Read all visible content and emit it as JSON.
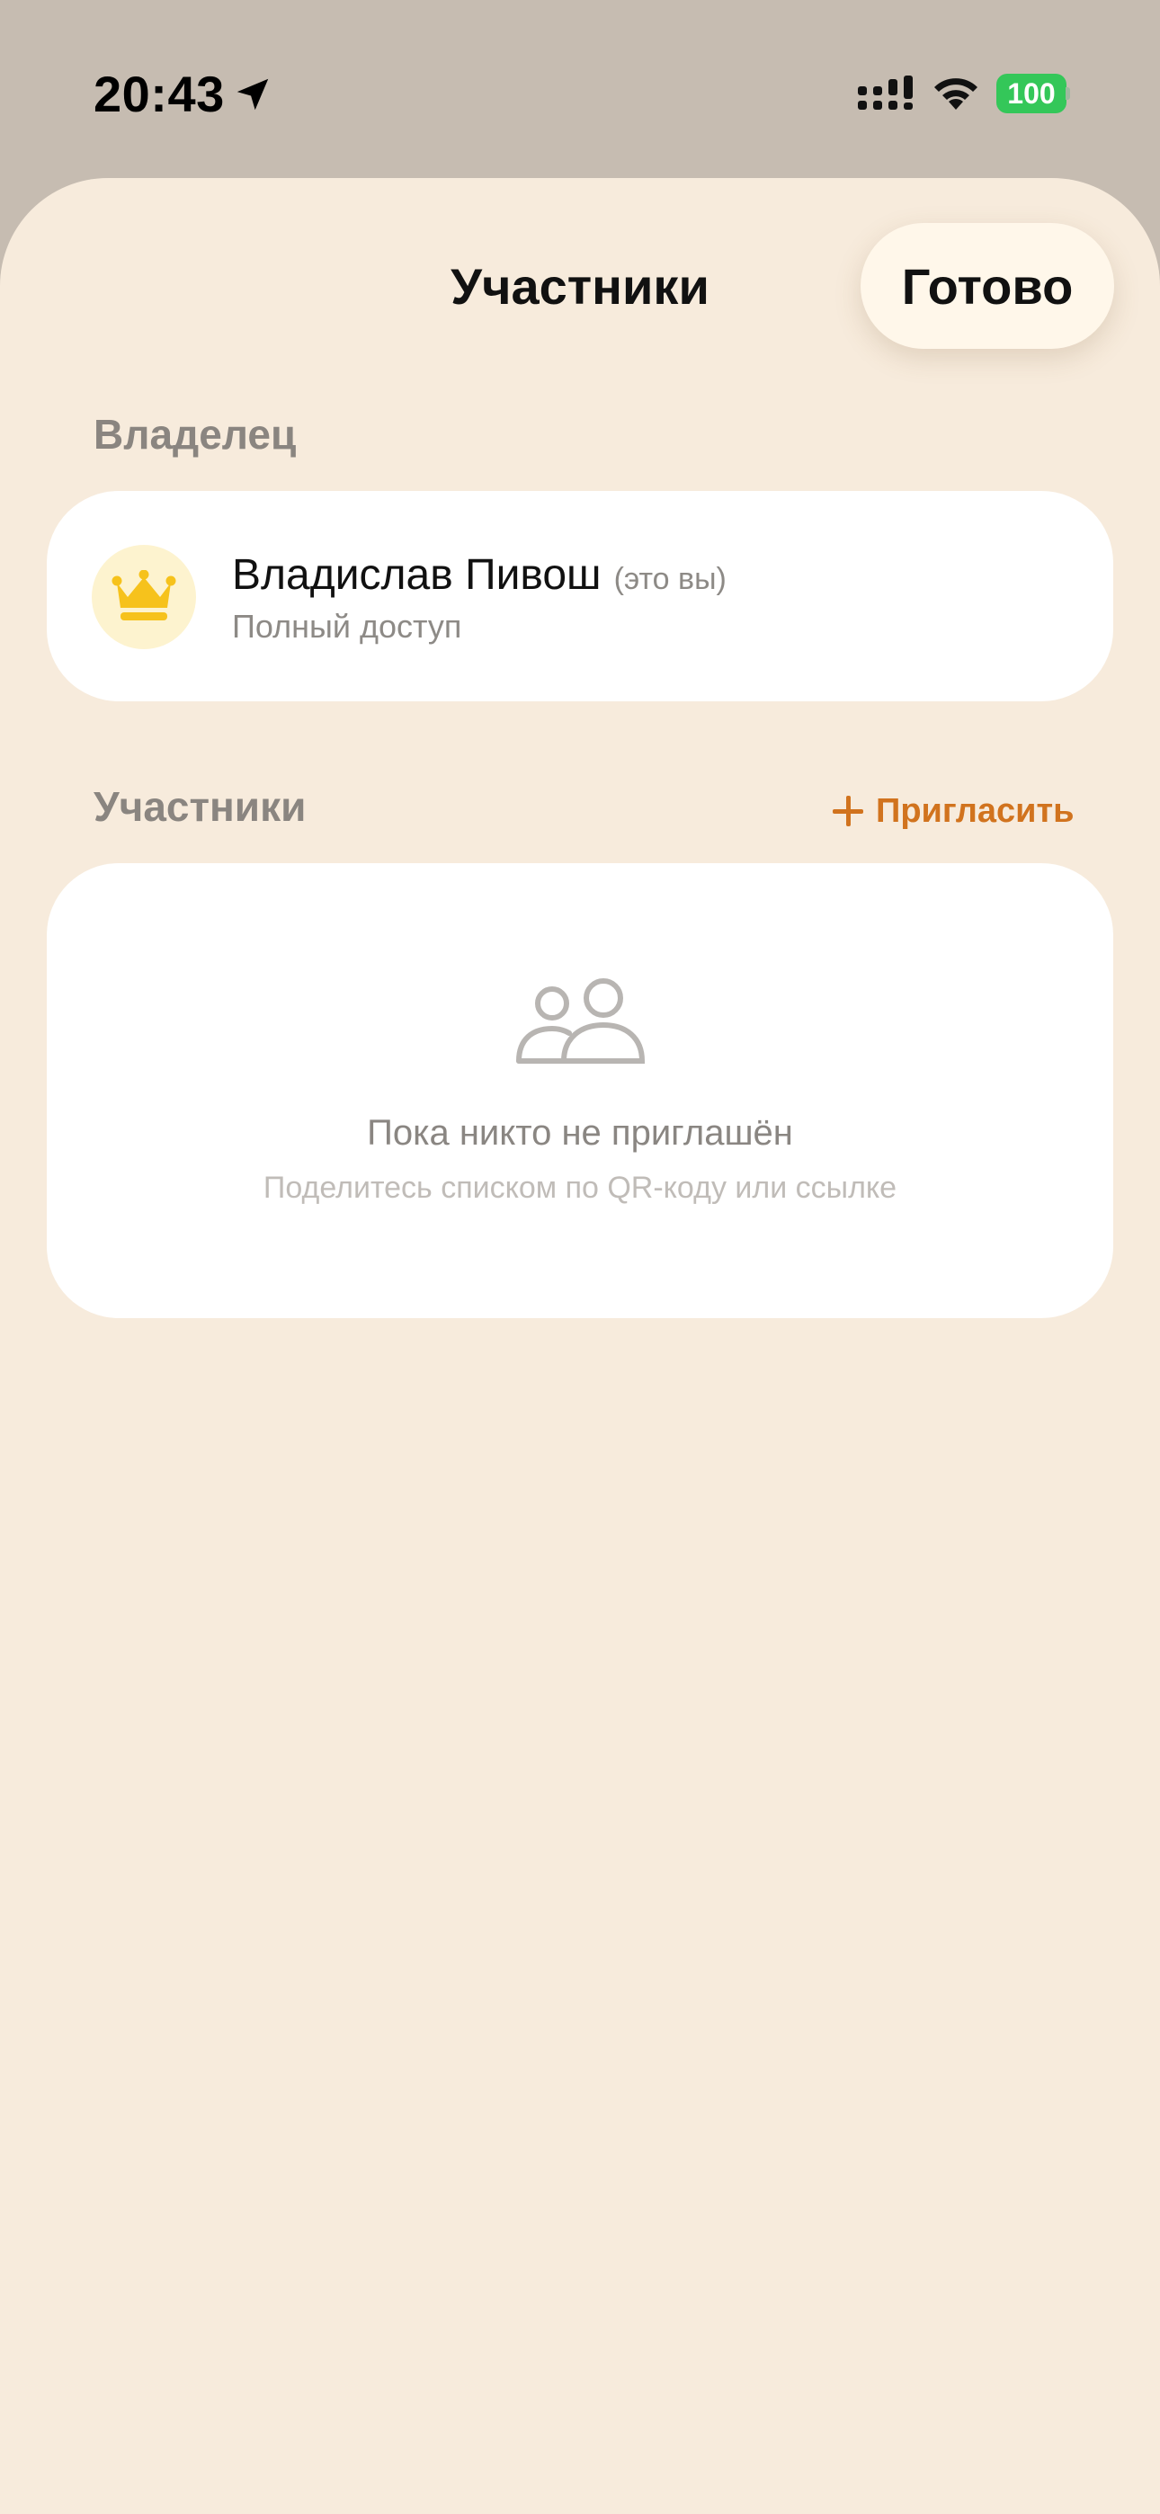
{
  "status_bar": {
    "time": "20:43",
    "battery_level": "100",
    "battery_color": "#34c759",
    "icons": [
      "location-arrow-icon",
      "signal-icon",
      "wifi-icon",
      "battery-icon"
    ]
  },
  "sheet": {
    "title": "Участники",
    "done_label": "Готово",
    "background": "#f7ebdc"
  },
  "owner_section": {
    "label": "Владелец",
    "owner": {
      "name": "Владислав Пивош",
      "you_tag": "(это вы)",
      "access": "Полный доступ",
      "icon": "crown-icon",
      "icon_color": "#f6c21c"
    }
  },
  "participants_section": {
    "label": "Участники",
    "invite_label": "Пригласить",
    "invite_color": "#d1731e",
    "empty_icon": "users-icon",
    "empty_title": "Пока никто не приглашён",
    "empty_subtitle": "Поделитесь списком по QR-коду или ссылке"
  }
}
